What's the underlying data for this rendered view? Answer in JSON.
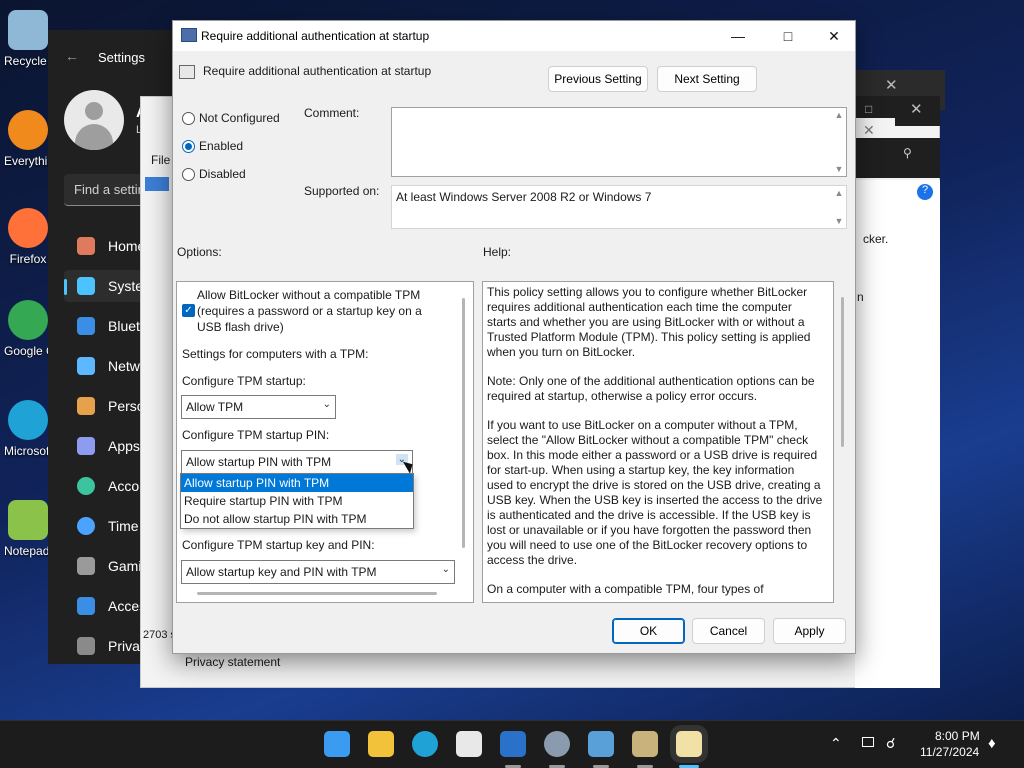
{
  "desktop_icons": [
    {
      "label": "Recycle Bin",
      "icon": "recycle-bin-icon",
      "color": "#8fb7d6"
    },
    {
      "label": "Everything",
      "icon": "everything-search-icon",
      "color": "#f08a1c"
    },
    {
      "label": "Firefox",
      "icon": "firefox-icon",
      "color": "#ff7139"
    },
    {
      "label": "Google Chrome",
      "icon": "chrome-icon",
      "color": "#34a853"
    },
    {
      "label": "Microsoft Edge",
      "icon": "edge-icon",
      "color": "#1fa3d6"
    },
    {
      "label": "Notepad++",
      "icon": "notepad-plus-plus-icon",
      "color": "#8bc34a"
    }
  ],
  "settings": {
    "title": "Settings",
    "account_name": "Ad",
    "account_sub": "L",
    "search_placeholder": "Find a setting",
    "nav": [
      {
        "label": "Home",
        "icon": "home-icon",
        "color": "#e07a5f",
        "selected": false
      },
      {
        "label": "System",
        "icon": "system-icon",
        "color": "#4cc2ff",
        "selected": true
      },
      {
        "label": "Bluetooth & devices",
        "icon": "bluetooth-icon",
        "color": "#3a8ee6",
        "selected": false
      },
      {
        "label": "Network & internet",
        "icon": "network-icon",
        "color": "#5eb8ff",
        "selected": false
      },
      {
        "label": "Personalization",
        "icon": "brush-icon",
        "color": "#e5a24a",
        "selected": false
      },
      {
        "label": "Apps",
        "icon": "apps-icon",
        "color": "#8d9cf0",
        "selected": false
      },
      {
        "label": "Accounts",
        "icon": "accounts-icon",
        "color": "#3bc49d",
        "selected": false
      },
      {
        "label": "Time & language",
        "icon": "time-language-icon",
        "color": "#4aa3ff",
        "selected": false
      },
      {
        "label": "Gaming",
        "icon": "gaming-icon",
        "color": "#9a9a9a",
        "selected": false
      },
      {
        "label": "Accessibility",
        "icon": "accessibility-icon",
        "color": "#3a8ee6",
        "selected": false
      },
      {
        "label": "Privacy & security",
        "icon": "shield-icon",
        "color": "#8a8a8a",
        "selected": false
      }
    ]
  },
  "background_window": {
    "file_menu": "File",
    "status_count": "2703 s",
    "privacy_link": "Privacy statement",
    "partial_text": "cker.",
    "partial_text2": "n"
  },
  "dialog": {
    "title": "Require additional authentication at startup",
    "setting_name": "Require additional authentication at startup",
    "prev_button": "Previous Setting",
    "next_button": "Next Setting",
    "radios": [
      {
        "label": "Not Configured",
        "checked": false
      },
      {
        "label": "Enabled",
        "checked": true
      },
      {
        "label": "Disabled",
        "checked": false
      }
    ],
    "comment_label": "Comment:",
    "supported_label": "Supported on:",
    "supported_value": "At least Windows Server 2008 R2 or Windows 7",
    "options_label": "Options:",
    "help_label": "Help:",
    "options": {
      "allow_no_tpm_label": "Allow BitLocker without a compatible TPM (requires a password or a startup key on a USB flash drive)",
      "allow_no_tpm_checked": true,
      "tpm_heading": "Settings for computers with a TPM:",
      "tpm_startup_label": "Configure TPM startup:",
      "tpm_startup_value": "Allow TPM",
      "tpm_pin_label": "Configure TPM startup PIN:",
      "tpm_pin_value": "Allow startup PIN with TPM",
      "tpm_pin_dropdown": [
        "Allow startup PIN with TPM",
        "Require startup PIN with TPM",
        "Do not allow startup PIN with TPM"
      ],
      "tpm_key_pin_label": "Configure TPM startup key and PIN:",
      "tpm_key_pin_value": "Allow startup key and PIN with TPM"
    },
    "help_paragraphs": [
      "This policy setting allows you to configure whether BitLocker requires additional authentication each time the computer starts and whether you are using BitLocker with or without a Trusted Platform Module (TPM). This policy setting is applied when you turn on BitLocker.",
      "Note: Only one of the additional authentication options can be required at startup, otherwise a policy error occurs.",
      "If you want to use BitLocker on a computer without a TPM, select the \"Allow BitLocker without a compatible TPM\" check box. In this mode either a password or a USB drive is required for start-up. When using a startup key, the key information used to encrypt the drive is stored on the USB drive, creating a USB key. When the USB key is inserted the access to the drive is authenticated and the drive is accessible. If the USB key is lost or unavailable or if you have forgotten the password then you will need to use one of the BitLocker recovery options to access the drive.",
      "On a computer with a compatible TPM, four types of"
    ],
    "ok_button": "OK",
    "cancel_button": "Cancel",
    "apply_button": "Apply"
  },
  "taskbar": {
    "apps": [
      {
        "icon": "start-icon",
        "color": "#3a9bf0"
      },
      {
        "icon": "file-explorer-icon",
        "color": "#f2c23a"
      },
      {
        "icon": "edge-icon",
        "color": "#1fa3d6"
      },
      {
        "icon": "store-icon",
        "color": "#e8e8e8"
      },
      {
        "icon": "outlook-icon",
        "color": "#2a72c9"
      },
      {
        "icon": "settings-gear-icon",
        "color": "#8a9bb0"
      },
      {
        "icon": "control-panel-icon",
        "color": "#5aa0d8"
      },
      {
        "icon": "group-policy-icon",
        "color": "#c9b27c"
      },
      {
        "icon": "notepad-icon",
        "color": "#f1e1a6"
      }
    ],
    "time": "8:00 PM",
    "date": "11/27/2024"
  },
  "colors": {
    "accent": "#0067c0",
    "selection": "#0078d7",
    "settings_bg": "#202020",
    "taskbar_bg": "#1c1c1c"
  }
}
